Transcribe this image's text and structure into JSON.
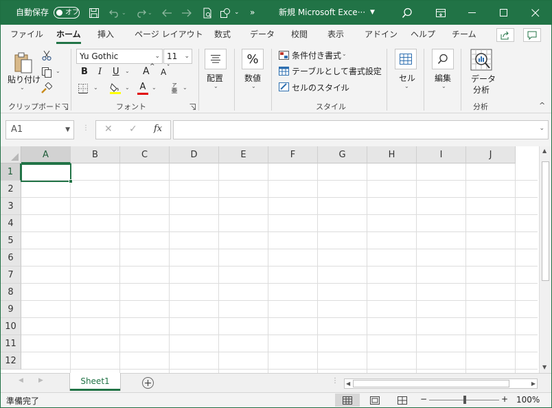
{
  "titlebar": {
    "autosave_label": "自動保存",
    "autosave_state": "オフ",
    "doc_title": "新規 Microsoft Exce···"
  },
  "tabs": [
    "ファイル",
    "ホーム",
    "挿入",
    "ページ レイアウト",
    "数式",
    "データ",
    "校閲",
    "表示",
    "アドイン",
    "ヘルプ",
    "チーム"
  ],
  "active_tab": "ホーム",
  "ribbon": {
    "clipboard": {
      "paste": "貼り付け",
      "group": "クリップボード"
    },
    "font": {
      "name": "Yu Gothic",
      "size": "11",
      "bold": "B",
      "italic": "I",
      "underline": "U",
      "grow": "A",
      "shrink": "A",
      "color_a": "A",
      "group": "フォント"
    },
    "alignment": {
      "label": "配置"
    },
    "number": {
      "label": "数値"
    },
    "styles": {
      "conditional": "条件付き書式",
      "table": "テーブルとして書式設定",
      "cell_styles": "セルのスタイル",
      "group": "スタイル"
    },
    "cells": {
      "label": "セル"
    },
    "editing": {
      "label": "編集"
    },
    "analysis": {
      "label_line1": "データ",
      "label_line2": "分析",
      "group": "分析"
    }
  },
  "formula_bar": {
    "name_box": "A1",
    "fx": "fx",
    "formula": ""
  },
  "columns": [
    "A",
    "B",
    "C",
    "D",
    "E",
    "F",
    "G",
    "H",
    "I",
    "J"
  ],
  "rows": [
    "1",
    "2",
    "3",
    "4",
    "5",
    "6",
    "7",
    "8",
    "9",
    "10",
    "11",
    "12"
  ],
  "selected_cell": "A1",
  "sheets": [
    "Sheet1"
  ],
  "status": {
    "text": "準備完了",
    "zoom": "100%"
  },
  "colors": {
    "accent": "#217346",
    "ribbon_bg": "#f3f3f3"
  }
}
